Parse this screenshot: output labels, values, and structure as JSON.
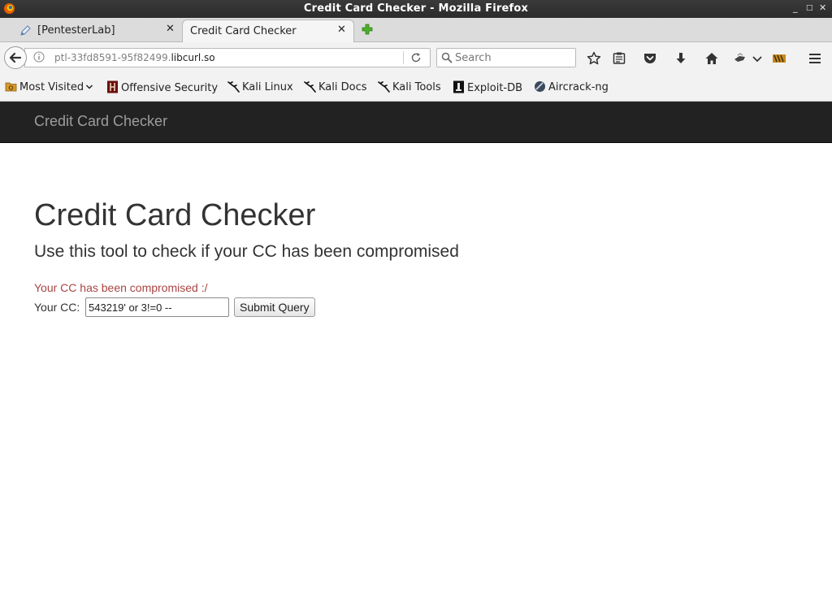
{
  "window": {
    "title": "Credit Card Checker - Mozilla Firefox",
    "controls": {
      "minimize": "_",
      "restore": "□",
      "close": "✕"
    }
  },
  "tabs": [
    {
      "label": "[PentesterLab]",
      "icon": "pencil-icon",
      "active": false
    },
    {
      "label": "Credit Card Checker",
      "icon": "",
      "active": true
    }
  ],
  "tab_close_glyph": "✕",
  "navbar": {
    "url_host_prefix": "ptl-33fd8591-95f82499.",
    "url_host_domain": "libcurl.so",
    "search_placeholder": "Search"
  },
  "bookmarks": [
    {
      "label": "Most Visited",
      "icon": "gear-folder-icon",
      "dropdown": true
    },
    {
      "label": "Offensive Security",
      "icon": "offsec-icon"
    },
    {
      "label": "Kali Linux",
      "icon": "kali-dragon-icon"
    },
    {
      "label": "Kali Docs",
      "icon": "kali-dragon-icon"
    },
    {
      "label": "Kali Tools",
      "icon": "kali-dragon-icon"
    },
    {
      "label": "Exploit-DB",
      "icon": "exploitdb-icon"
    },
    {
      "label": "Aircrack-ng",
      "icon": "aircrack-icon"
    }
  ],
  "page": {
    "brand": "Credit Card Checker",
    "heading": "Credit Card Checker",
    "lead": "Use this tool to check if your CC has been compromised",
    "error": "Your CC has been compromised :/",
    "cc_label": "Your CC:",
    "cc_value": "543219' or 3!=0 --",
    "submit_label": "Submit Query"
  },
  "colors": {
    "page_navbar": "#222222",
    "brand_text": "#9d9d9d",
    "error_text": "#a94442",
    "body_text": "#333333"
  }
}
